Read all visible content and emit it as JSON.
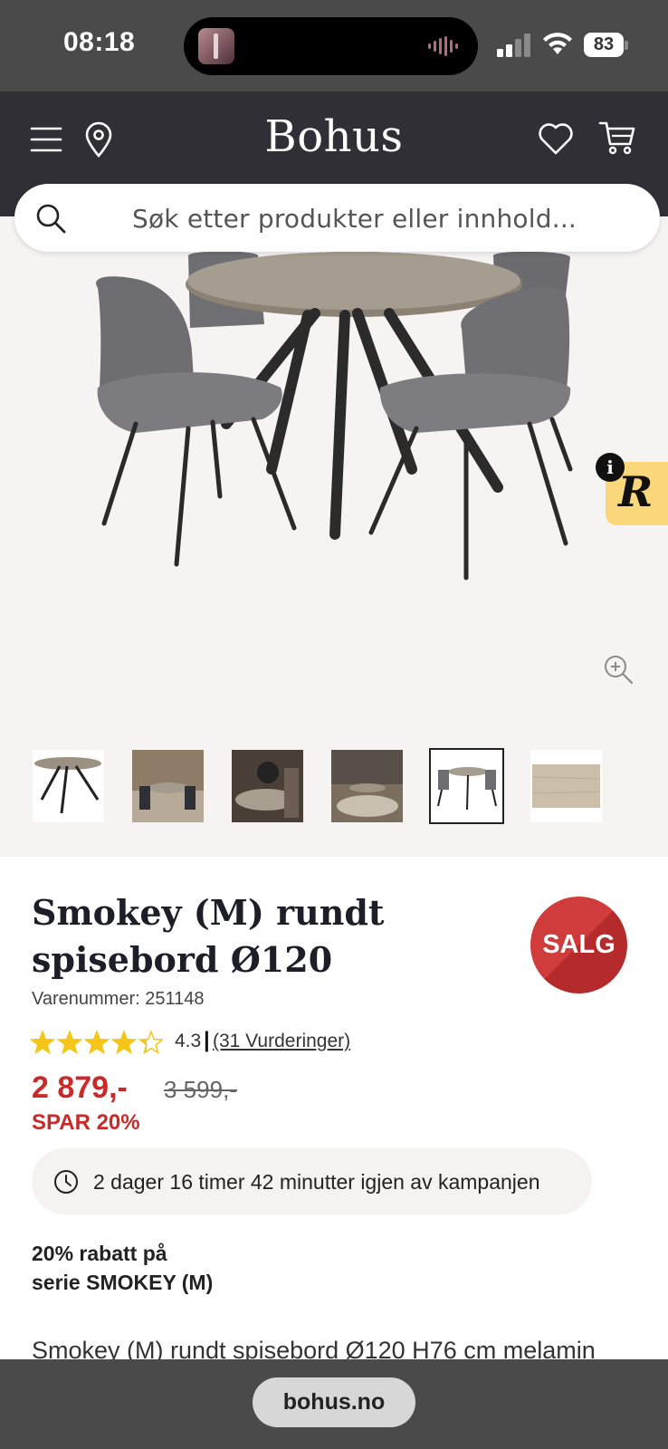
{
  "status_bar": {
    "time": "08:18",
    "battery": "83"
  },
  "header": {
    "logo": "Bohus"
  },
  "search": {
    "placeholder": "Søk etter produkter eller innhold..."
  },
  "gallery": {
    "thumbnails": [
      "thumb-table",
      "thumb-room-1",
      "thumb-room-2",
      "thumb-room-3",
      "thumb-set",
      "thumb-wood"
    ],
    "active_index": 4
  },
  "product": {
    "title_line1": "Smokey (M) rundt",
    "title_line2": "spisebord Ø120",
    "sku": "Varenummer: 251148",
    "badge": "SALG",
    "rating": "4.3",
    "rating_value": 4.3,
    "separator": "|",
    "reviews": "(31 Vurderinger)",
    "price": "2 879,-",
    "old_price": "3 599,-",
    "saving": "SPAR 20%",
    "campaign": "2 dager 16 timer 42 minutter igjen av kampanjen",
    "discount_line1": "20% rabatt på",
    "discount_line2": "serie SMOKEY (M)",
    "description": "Smokey (M) rundt spisebord Ø120 H76 cm melamin"
  },
  "browser": {
    "url": "bohus.no"
  },
  "colors": {
    "header": "#2f2f35",
    "sale_red": "#c92a2a",
    "star": "#f5c518",
    "badge_yellow": "#fbd77c"
  }
}
